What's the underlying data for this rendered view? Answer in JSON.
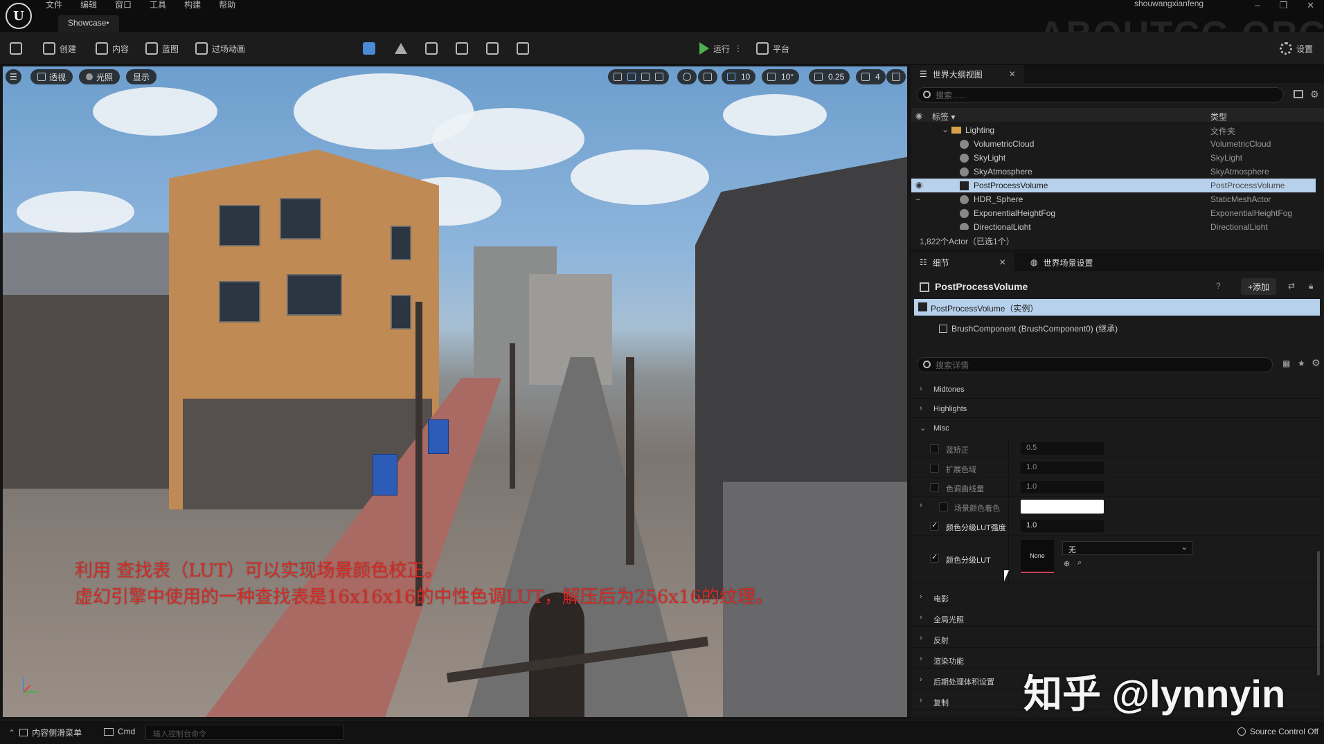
{
  "titlebar": {
    "menus": [
      "文件",
      "编辑",
      "窗口",
      "工具",
      "构建",
      "帮助"
    ],
    "doc_tab": "Showcase•",
    "user": "shouwangxianfeng",
    "watermark": "ABOUTCG.ORG",
    "window_buttons": [
      "–",
      "❐",
      "✕"
    ]
  },
  "toolbar": {
    "create": "创建",
    "content": "内容",
    "blueprint": "蓝图",
    "cinematics": "过场动画",
    "run": "运行",
    "platform": "平台",
    "settings": "设置"
  },
  "viewport": {
    "perspective": "透视",
    "lighting": "光照",
    "show": "显示",
    "grid_snap": "10",
    "angle_snap": "10°",
    "scale_snap": "0.25",
    "camera_speed": "4",
    "subtitle_line1": "利用 查找表（LUT）可以实现场景颜色校正。",
    "subtitle_line2": "虚幻引擎中使用的一种查找表是16x16x16的中性色调LUT，解压后为256x16的纹理。"
  },
  "outliner": {
    "tab": "世界大纲视图",
    "search_placeholder": "搜索......",
    "col_label": "标签 ▾",
    "col_type": "类型",
    "rows": [
      {
        "name": "Lighting",
        "type": "文件夹"
      },
      {
        "name": "VolumetricCloud",
        "type": "VolumetricCloud"
      },
      {
        "name": "SkyLight",
        "type": "SkyLight"
      },
      {
        "name": "SkyAtmosphere",
        "type": "SkyAtmosphere"
      },
      {
        "name": "PostProcessVolume",
        "type": "PostProcessVolume"
      },
      {
        "name": "HDR_Sphere",
        "type": "StaticMeshActor"
      },
      {
        "name": "ExponentialHeightFog",
        "type": "ExponentialHeightFog"
      },
      {
        "name": "DirectionalLight",
        "type": "DirectionalLight"
      }
    ],
    "actor_count": "1,822个Actor（已选1个）"
  },
  "details": {
    "tab_details": "细节",
    "tab_world": "世界场景设置",
    "title": "PostProcessVolume",
    "add_button": "+添加",
    "component_instance": "PostProcessVolume（实例）",
    "component_brush": "BrushComponent (BrushComponent0) (继承)",
    "search_placeholder": "搜索详情",
    "sections_top": [
      "Midtones",
      "Highlights",
      "Misc"
    ],
    "props": [
      {
        "label": "蓝矫正",
        "value": "0.5",
        "on": false
      },
      {
        "label": "扩展色域",
        "value": "1.0",
        "on": false
      },
      {
        "label": "色调曲线量",
        "value": "1.0",
        "on": false
      },
      {
        "label": "场景颜色着色",
        "value": "",
        "on": false
      },
      {
        "label": "颜色分级LUT强度",
        "value": "1.0",
        "on": true
      }
    ],
    "lut_label": "颜色分级LUT",
    "lut_thumb": "None",
    "lut_dropdown": "无",
    "sections_bottom": [
      "电影",
      "全局光照",
      "反射",
      "渲染功能",
      "后期处理体积设置",
      "复制"
    ]
  },
  "statusbar": {
    "content_drawer": "内容侧滑菜单",
    "cmd": "Cmd",
    "console_placeholder": "输入控制台命令",
    "source_control": "Source Control Off"
  },
  "zhihu_watermark": "知乎 @lynnyin"
}
